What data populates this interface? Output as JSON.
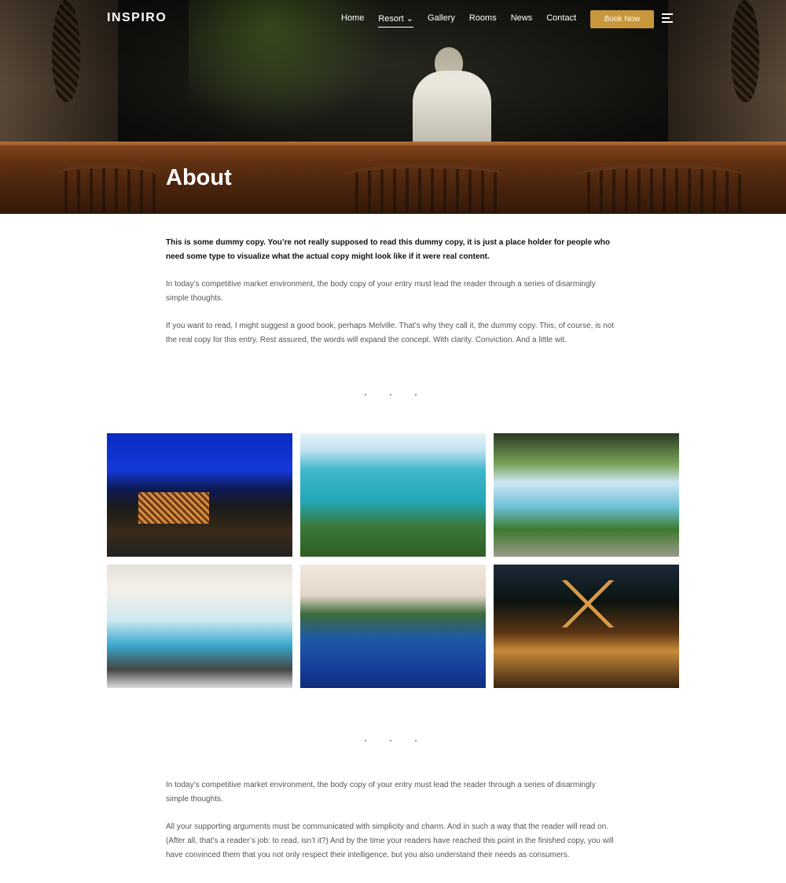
{
  "header": {
    "logo": "INSPIRO",
    "nav": [
      {
        "label": "Home"
      },
      {
        "label": "Resort ⌄"
      },
      {
        "label": "Gallery"
      },
      {
        "label": "Rooms"
      },
      {
        "label": "News"
      },
      {
        "label": "Contact"
      }
    ],
    "book_label": "Book Now",
    "menu_icon": "hamburger-menu-icon"
  },
  "hero": {
    "title": "About"
  },
  "intro": {
    "lead": "This is some dummy copy. You’re not really supposed to read this dummy copy, it is just a place holder for people who need some type to visualize what the actual copy might look like if it were real content.",
    "p1": "In today’s competitive market environment, the body copy of your entry must lead the reader through a series of disarmingly simple thoughts.",
    "p2": "If you want to read, I might suggest a good book, perhaps Melville. That’s why they call it, the dummy copy. This, of course, is not the real copy for this entry. Rest assured, the words will expand the concept. With clarity. Conviction. And a little wit."
  },
  "gallery": {
    "images": [
      {
        "alt": "overwater resort building at night"
      },
      {
        "alt": "turquoise bay with jetty"
      },
      {
        "alt": "tropical pool with rocks"
      },
      {
        "alt": "infinity pool with palm trees"
      },
      {
        "alt": "blue pool at sunset"
      },
      {
        "alt": "lit wooden gazebo at night"
      }
    ]
  },
  "outro": {
    "p1": "In today’s competitive market environment, the body copy of your entry must lead the reader through a series of disarmingly simple thoughts.",
    "p2": "All your supporting arguments must be communicated with simplicity and charm. And in such a way that the reader will read on. (After all, that’s a reader’s job: to read, isn’t it?) And by the time your readers have reached this point in the finished copy, you will have convinced them that you not only respect their intelligence, but you also understand their needs as consumers."
  },
  "colors": {
    "accent": "#c8963b",
    "text_dark": "#111111",
    "text_body": "#555555"
  }
}
